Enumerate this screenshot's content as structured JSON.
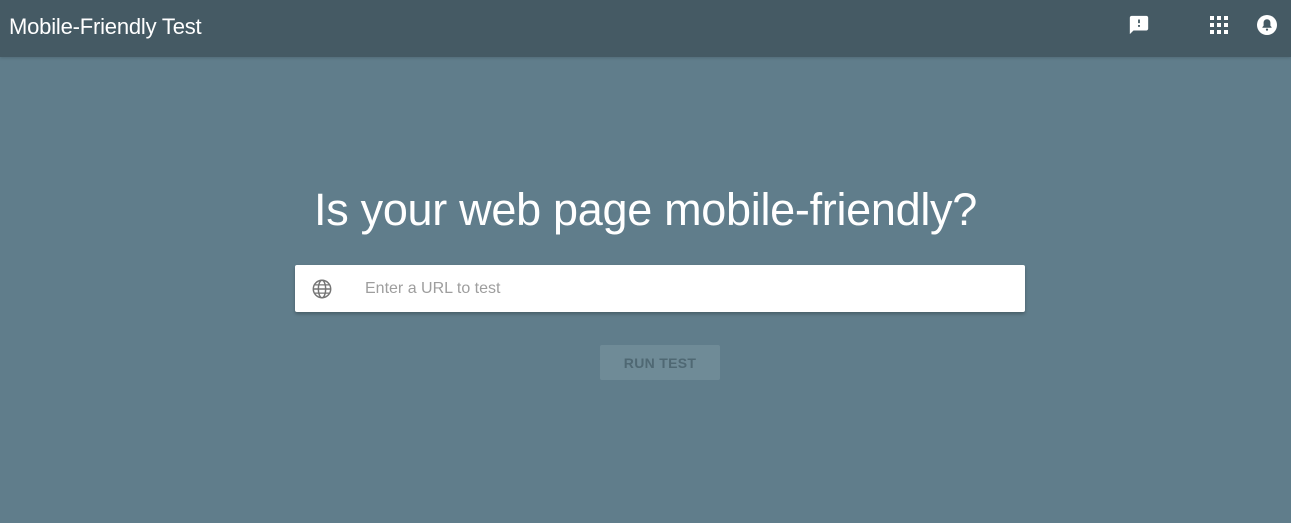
{
  "app": {
    "title": "Mobile-Friendly Test"
  },
  "header": {
    "icons": [
      "feedback-icon",
      "apps-grid-icon",
      "notifications-icon"
    ]
  },
  "main": {
    "headline": "Is your web page mobile-friendly?",
    "url_input": {
      "value": "",
      "placeholder": "Enter a URL to test",
      "icon": "globe-icon"
    },
    "run_button_label": "RUN TEST"
  },
  "colors": {
    "page_background": "#607d8b",
    "header_background": "#455a64",
    "input_background": "#ffffff",
    "button_disabled_background": "#6f8b97",
    "button_disabled_text": "#4f6873"
  }
}
